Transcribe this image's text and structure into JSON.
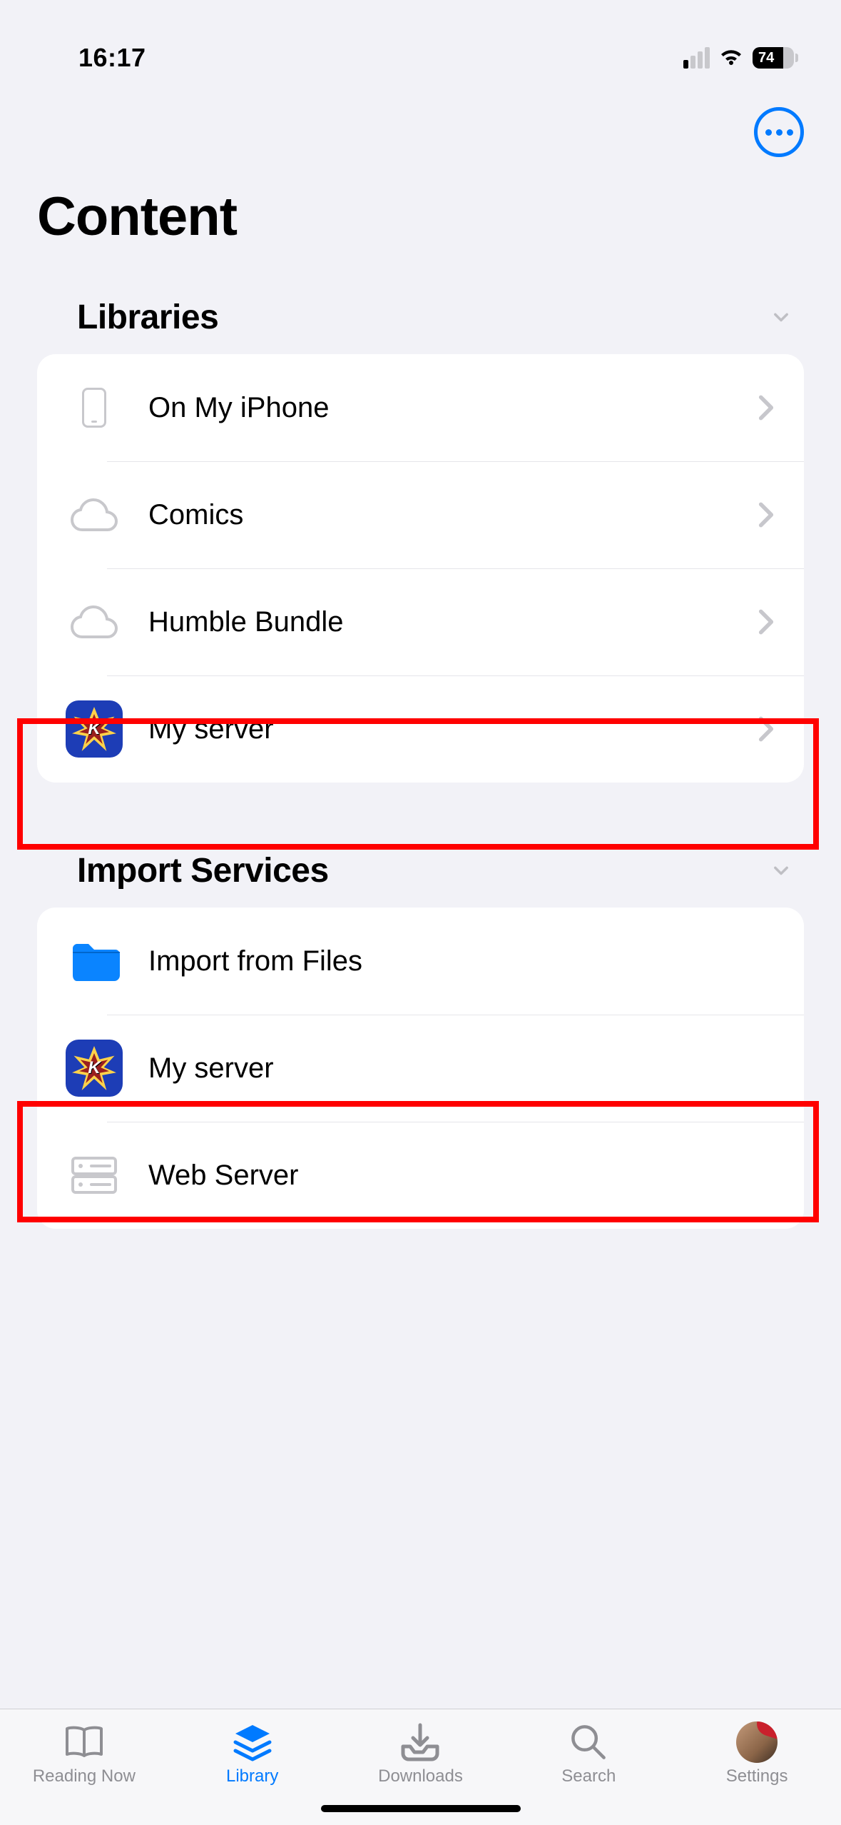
{
  "status": {
    "time": "16:17",
    "battery_pct": "74"
  },
  "page": {
    "title": "Content"
  },
  "sections": {
    "libraries": {
      "title": "Libraries",
      "items": [
        {
          "label": "On My iPhone"
        },
        {
          "label": "Comics"
        },
        {
          "label": "Humble Bundle"
        },
        {
          "label": "My server"
        }
      ]
    },
    "import": {
      "title": "Import Services",
      "items": [
        {
          "label": "Import from Files"
        },
        {
          "label": "My server"
        },
        {
          "label": "Web Server"
        }
      ]
    }
  },
  "tabs": {
    "reading_now": "Reading Now",
    "library": "Library",
    "downloads": "Downloads",
    "search": "Search",
    "settings": "Settings"
  }
}
